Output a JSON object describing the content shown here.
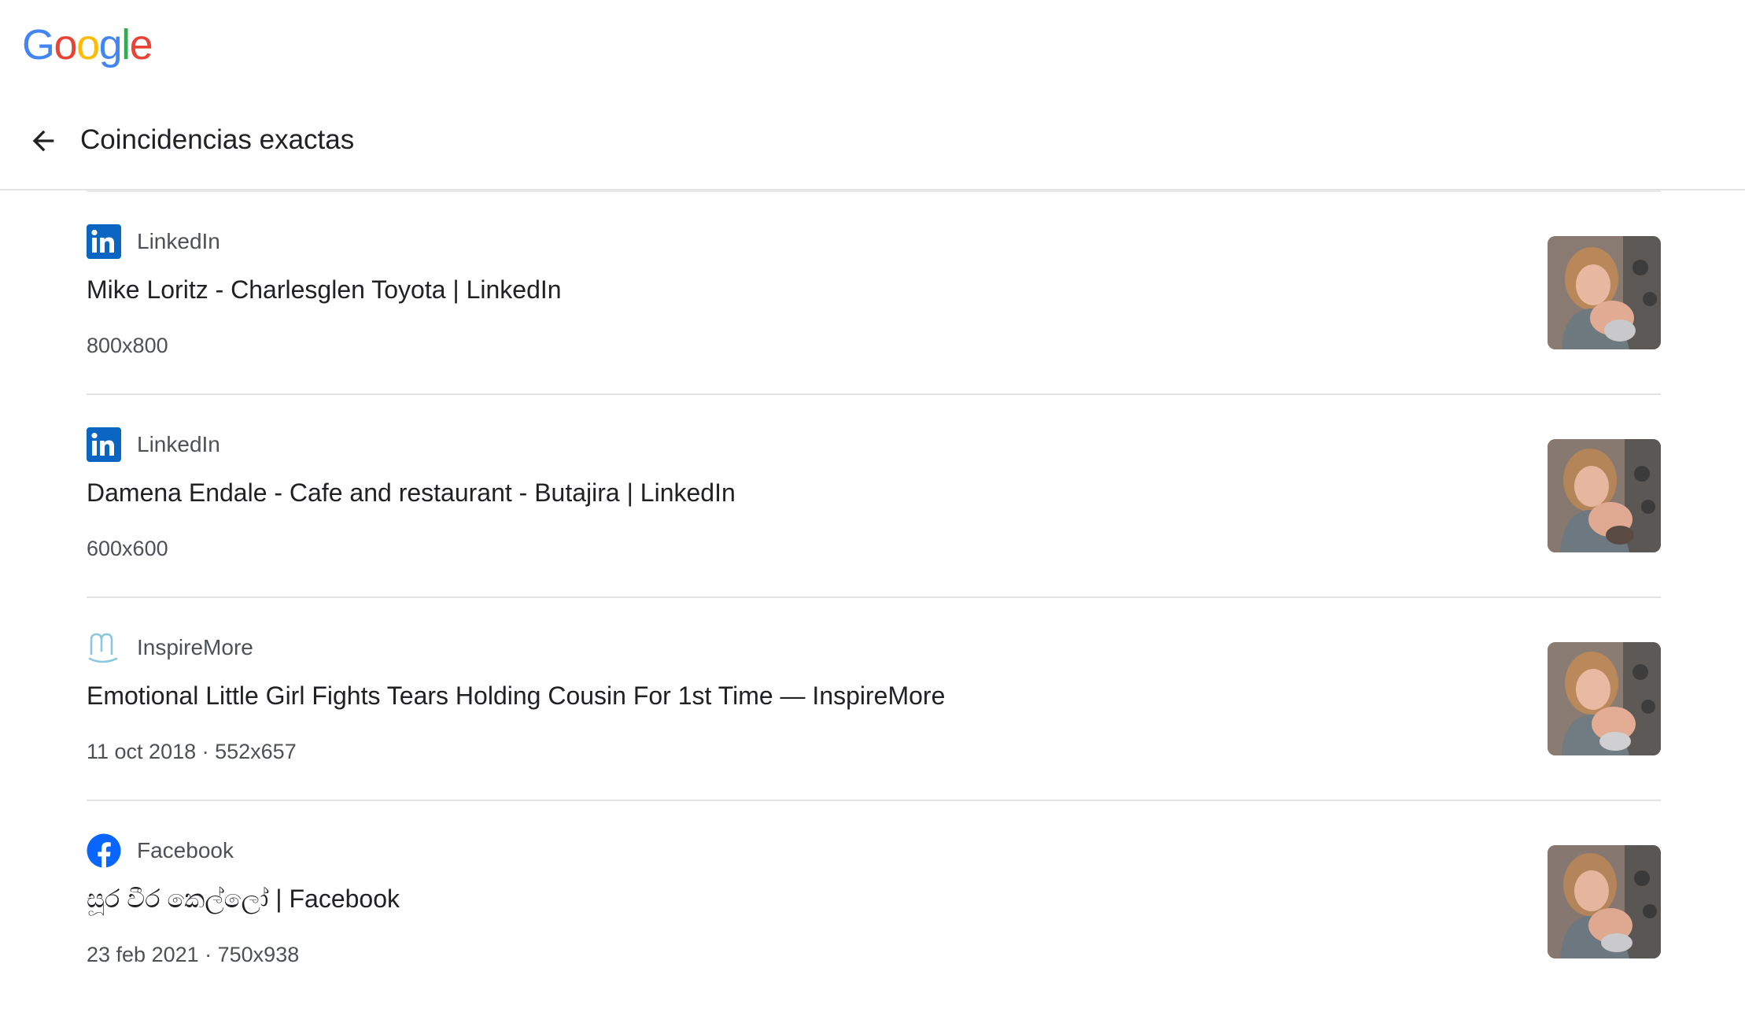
{
  "logo": {
    "letters": [
      {
        "char": "G",
        "color": "#4285F4"
      },
      {
        "char": "o",
        "color": "#EA4335"
      },
      {
        "char": "o",
        "color": "#FBBC05"
      },
      {
        "char": "g",
        "color": "#4285F4"
      },
      {
        "char": "l",
        "color": "#34A853"
      },
      {
        "char": "e",
        "color": "#EA4335"
      }
    ]
  },
  "header": {
    "title": "Coincidencias exactas",
    "back_icon": "arrow-back-icon"
  },
  "results": [
    {
      "source": "LinkedIn",
      "favicon": "linkedin-icon",
      "title": "Mike Loritz - Charlesglen Toyota | LinkedIn",
      "meta": "800x800"
    },
    {
      "source": "LinkedIn",
      "favicon": "linkedin-icon",
      "title": "Damena Endale - Cafe and restaurant - Butajira | LinkedIn",
      "meta": "600x600"
    },
    {
      "source": "InspireMore",
      "favicon": "inspiremore-icon",
      "title": "Emotional Little Girl Fights Tears Holding Cousin For 1st Time — InspireMore",
      "meta": "11 oct 2018 · 552x657"
    },
    {
      "source": "Facebook",
      "favicon": "facebook-icon",
      "title": "සූර වීර කෙල්ලෝ | Facebook",
      "meta": "23 feb 2021 · 750x938"
    }
  ],
  "colors": {
    "linkedin": "#0A66C2",
    "facebook": "#0866FF",
    "inspiremore": "#8CC7E0",
    "divider": "#E3E3E3",
    "text_primary": "#202124",
    "text_secondary": "#4D5156"
  }
}
